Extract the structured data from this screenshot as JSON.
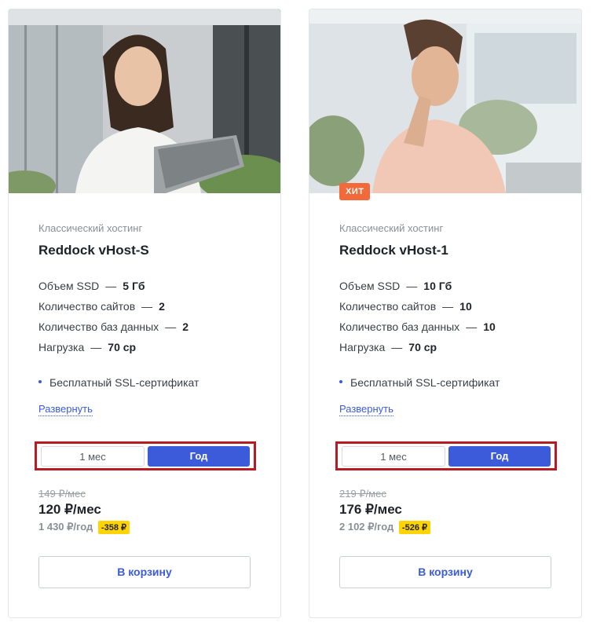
{
  "products": [
    {
      "category": "Классический хостинг",
      "name": "Reddock vHost-S",
      "badge": "",
      "specs": [
        {
          "label": "Объем SSD",
          "value": "5 Гб"
        },
        {
          "label": "Количество сайтов",
          "value": "2"
        },
        {
          "label": "Количество баз данных",
          "value": "2"
        },
        {
          "label": "Нагрузка",
          "value": "70 cp"
        }
      ],
      "feature": "Бесплатный SSL-сертификат",
      "expand_label": "Развернуть",
      "period_month": "1 мес",
      "period_year": "Год",
      "selected_period": "Год",
      "old_price": "149 ₽/мес",
      "price": "120 ₽/мес",
      "year_price": "1 430 ₽/год",
      "discount": "-358 ₽",
      "cart_label": "В корзину"
    },
    {
      "category": "Классический хостинг",
      "name": "Reddock vHost-1",
      "badge": "ХИТ",
      "specs": [
        {
          "label": "Объем SSD",
          "value": "10 Гб"
        },
        {
          "label": "Количество сайтов",
          "value": "10"
        },
        {
          "label": "Количество баз данных",
          "value": "10"
        },
        {
          "label": "Нагрузка",
          "value": "70 cp"
        }
      ],
      "feature": "Бесплатный SSL-сертификат",
      "expand_label": "Развернуть",
      "period_month": "1 мес",
      "period_year": "Год",
      "selected_period": "Год",
      "old_price": "219 ₽/мес",
      "price": "176 ₽/мес",
      "year_price": "2 102 ₽/год",
      "discount": "-526 ₽",
      "cart_label": "В корзину"
    }
  ],
  "colors": {
    "accent": "#3b5bdb",
    "badge": "#f26a3a",
    "discount": "#ffd400",
    "highlight_border": "#b71c24"
  },
  "separator": "—"
}
